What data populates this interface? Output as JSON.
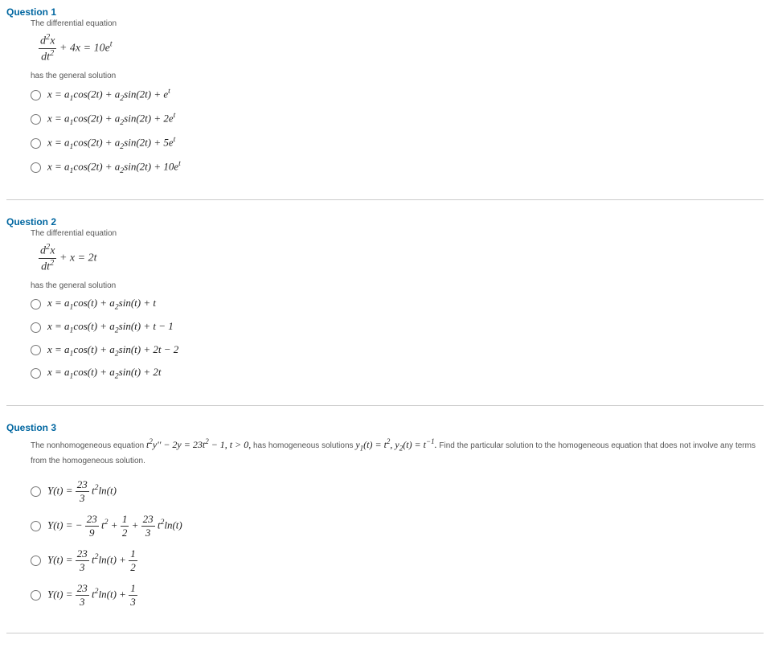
{
  "q1": {
    "title": "Question 1",
    "stem1": "The differential equation",
    "stem2": "has the general solution",
    "eq_rhs": " + 4x = 10e",
    "opts": {
      "a_pre": "x = a",
      "a_mid1": "cos(2t) + a",
      "a_mid2": "sin(2t) + e",
      "b_pre": "x = a",
      "b_mid1": "cos(2t) + a",
      "b_mid2": "sin(2t) + 2e",
      "c_pre": "x = a",
      "c_mid1": "cos(2t) + a",
      "c_mid2": "sin(2t) + 5e",
      "d_pre": "x = a",
      "d_mid1": "cos(2t) + a",
      "d_mid2": "sin(2t) + 10e"
    }
  },
  "q2": {
    "title": "Question 2",
    "stem1": "The differential equation",
    "stem2": "has the general solution",
    "eq_rhs": " + x = 2t",
    "opts": {
      "a": "cos(t) + a",
      "a2": "sin(t) + t",
      "b": "cos(t) + a",
      "b2": "sin(t) + t − 1",
      "c": "cos(t) + a",
      "c2": "sin(t) + 2t − 2",
      "d": "cos(t) + a",
      "d2": "sin(t) + 2t"
    },
    "xa": "x = a"
  },
  "q3": {
    "title": "Question 3",
    "stem_a": "The nonhomogeneous equation ",
    "stem_b": " has homogeneous solutions ",
    "stem_c": " Find the particular solution to the homogeneous equation that does not involve any terms from the homogeneous solution.",
    "eq_main": "y'' − 2y = 23t",
    "eq_main2": " − 1, t > 0,",
    "y1": "(t) = t",
    "y2": "(t) = t",
    "Y": "Y(t) = ",
    "Yneg": "Y(t) = − ",
    "ln": "ln(t)",
    "plus": " + ",
    "t2": "t"
  },
  "frac": {
    "d2x": "d",
    "d2x_x": "x",
    "dt2": "dt",
    "n23": "23",
    "n3": "3",
    "n9": "9",
    "n1": "1",
    "n2": "2"
  }
}
